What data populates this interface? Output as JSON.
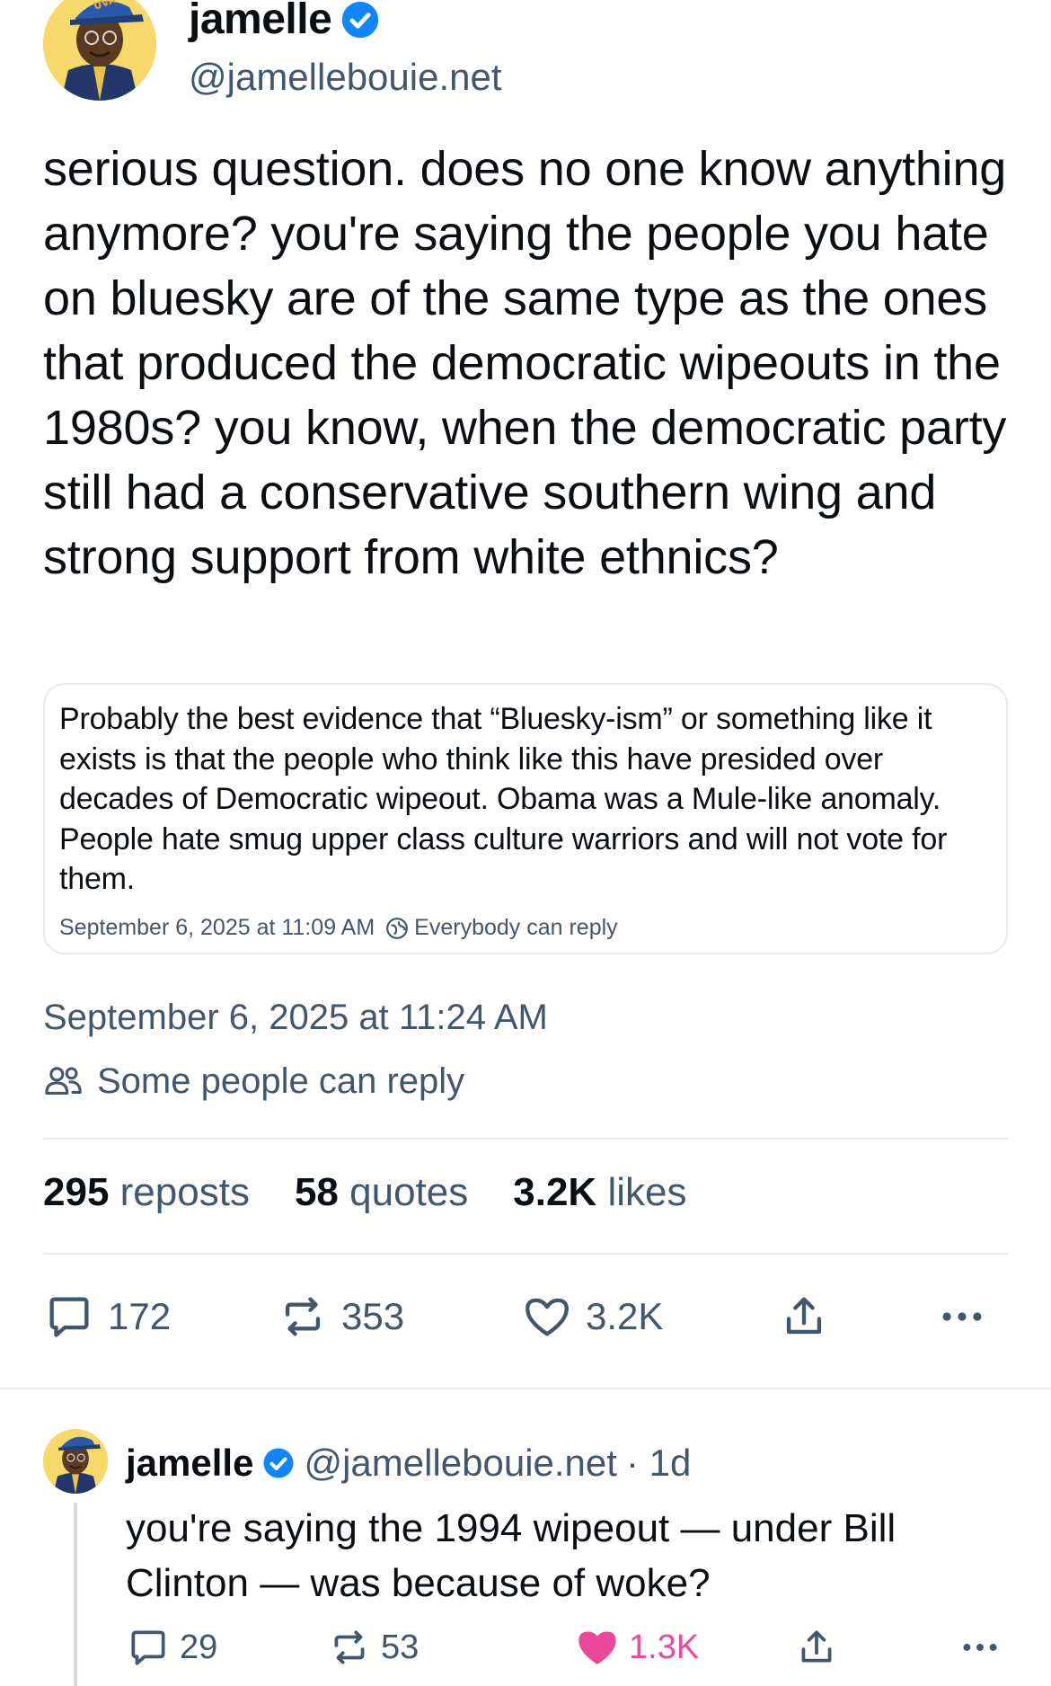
{
  "author": {
    "name": "jamelle",
    "handle": "@jamellebouie.net",
    "avatar_cap_text": "UVA"
  },
  "post": {
    "text": "serious question. does no one know anything anymore? you're saying the people you hate on bluesky are of the same type as the ones that produced the democratic wipeouts in the 1980s? you know, when the democratic party still had a conservative southern wing and strong support from white ethnics?",
    "timestamp": "September 6, 2025 at 11:24 AM",
    "reply_setting": "Some people can reply"
  },
  "quote": {
    "text": "Probably the best evidence that “Bluesky-ism” or something like it exists is that the people who think like this have presided over decades of Democratic wipeout. Obama was a Mule-like anomaly. People hate smug upper class culture warriors and will not vote for them.",
    "timestamp": "September 6, 2025 at 11:09 AM",
    "reply_setting": "Everybody can reply"
  },
  "stats": {
    "reposts_count": "295",
    "reposts_label": "reposts",
    "quotes_count": "58",
    "quotes_label": "quotes",
    "likes_count": "3.2K",
    "likes_label": "likes"
  },
  "actions": {
    "replies": "172",
    "reposts": "353",
    "likes": "3.2K"
  },
  "reply": {
    "name": "jamelle",
    "handle": "@jamellebouie.net",
    "age": "· 1d",
    "text": "you're saying the 1994 wipeout — under Bill Clinton — was because of woke?",
    "replies": "29",
    "reposts": "53",
    "likes": "1.3K"
  },
  "colors": {
    "accent_blue": "#1185fe",
    "muted_text": "#42576c",
    "like_pink": "#ec4899",
    "divider": "#e6e9ee"
  }
}
